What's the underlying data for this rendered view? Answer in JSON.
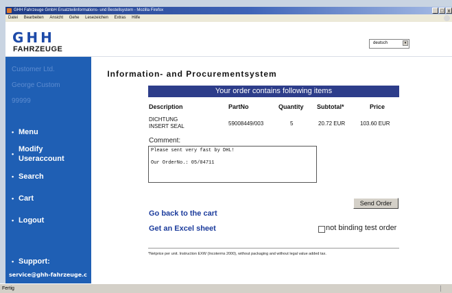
{
  "window": {
    "title": "GHH Fahrzeuge GmbH Ersatzteilinformations- und Bestellsystem - Mozilla Firefox",
    "controls": [
      "_",
      "□",
      "x"
    ]
  },
  "menubar": [
    "Datei",
    "Bearbeiten",
    "Ansicht",
    "Gehe",
    "Lesezeichen",
    "Extras",
    "Hilfe"
  ],
  "header": {
    "logo_main": "GHH",
    "logo_sub": "FAHRZEUGE",
    "language": "deutsch",
    "language_arrow": "▾"
  },
  "sidebar": {
    "customer": "Customer Ltd.",
    "user": "George Custom",
    "number": "99999",
    "bullet": "•",
    "nav": [
      "Menu",
      "Modify Useraccount",
      "Search",
      "Cart",
      "Logout"
    ],
    "support_label": "Support:",
    "support_email": "service@ghh-fahrzeuge.c"
  },
  "main": {
    "heading": "Information- and Procurementsystem",
    "banner": "Your order contains following items",
    "columns": [
      "Description",
      "PartNo",
      "Quantity",
      "Subtotal*",
      "Price"
    ],
    "items": [
      {
        "description_line1": "DICHTUNG",
        "description_line2": "INSERT SEAL",
        "partno": "59008449/003",
        "quantity": "5",
        "subtotal": "20.72 EUR",
        "price": "103.60 EUR"
      }
    ],
    "comment_label": "Comment:",
    "comment_value": "Please sent very fast by DHL!\n\nOur OrderNo.: 05/04711",
    "send_button": "Send Order",
    "link_back": "Go back to the cart",
    "link_excel": "Get an Excel sheet",
    "test_order_label": "not binding test order",
    "test_order_checked": false,
    "footnote": "*Netprice per unit. Instruction EXW (Incoterms 2000), without packaging and without legal value added tax."
  },
  "statusbar": {
    "text": "Fertig"
  }
}
